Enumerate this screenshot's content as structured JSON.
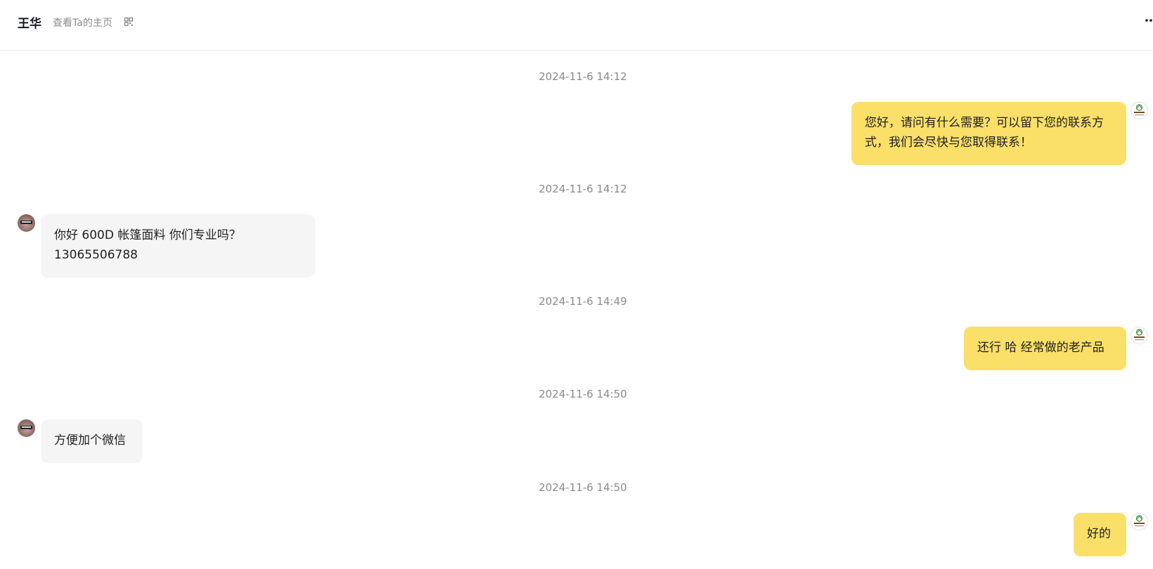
{
  "header": {
    "name": "王华",
    "profile_link": "查看Ta的主页",
    "qr_icon": "qrcode-icon",
    "more_icon": "more-icon"
  },
  "messages": [
    {
      "time": "2024-11-6 14:12",
      "from": "self",
      "text": "您好，请问有什么需要？可以留下您的联系方式，我们会尽快与您取得联系！"
    },
    {
      "time": "2024-11-6 14:12",
      "from": "peer",
      "text": "你好  600D 帐篷面料 你们专业吗？ 13065506788"
    },
    {
      "time": "2024-11-6 14:49",
      "from": "self",
      "text": "还行  哈 经常做的老产品"
    },
    {
      "time": "2024-11-6 14:50",
      "from": "peer",
      "text": "方便加个微信"
    },
    {
      "time": "2024-11-6 14:50",
      "from": "self",
      "text": "好的"
    }
  ],
  "colors": {
    "outgoing_bubble": "#fadf69",
    "incoming_bubble": "#f5f5f5",
    "timestamp": "#8a8a8a"
  }
}
